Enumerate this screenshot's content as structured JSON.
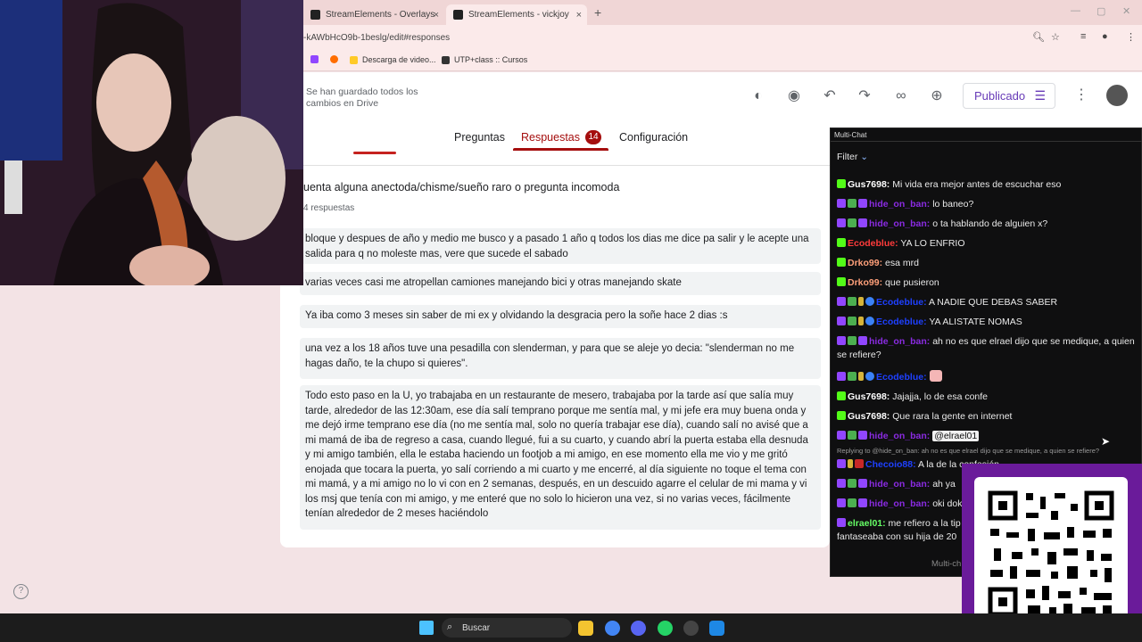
{
  "browser": {
    "tabs": [
      {
        "label": "StreamElements - Overlays",
        "close": "×"
      },
      {
        "label": "StreamElements - vickjoy",
        "close": "×"
      }
    ],
    "new_tab": "+",
    "url": "-kAWbHcO9b-1beslg/edit#responses",
    "bookmarks": [
      "Descarga de video...",
      "UTP+class :: Cursos"
    ]
  },
  "forms": {
    "saved_status": "Se han guardado todos los cambios en Drive",
    "publish_label": "Publicado",
    "tabs": {
      "questions": "Preguntas",
      "responses": "Respuestas",
      "settings": "Configuración"
    },
    "responses_count": "14",
    "question_title": "uenta alguna anectoda/chisme/sueño raro o pregunta incomoda",
    "question_count": "4 respuestas",
    "responses": [
      "bloque y despues de año y medio me busco y a pasado 1 año q todos los dias me dice pa salir y le acepte una salida para q no moleste mas, vere que sucede el sabado",
      "varias veces casi me atropellan camiones manejando bici y otras manejando skate",
      "Ya iba como 3 meses sin saber de mi ex y olvidando la desgracia pero la soñe hace 2 dias :s",
      "una vez a los 18 años tuve una pesadilla con slenderman, y para que se aleje yo decia: \"slenderman no me hagas daño, te la chupo si quieres\".",
      "Todo esto paso en la U, yo trabajaba en un restaurante de mesero, trabajaba por la tarde así que salía muy tarde, alrededor de las 12:30am, ese día salí temprano porque me sentía mal, y mi jefe era muy buena onda y me dejó irme temprano ese día (no me sentía mal, solo no quería trabajar ese día), cuando salí no avisé que a mi mamá de iba de regreso a casa, cuando llegué, fui a su cuarto, y cuando abrí la puerta estaba ella desnuda y mi amigo también, ella le estaba haciendo un footjob a mi amigo, en ese momento ella me vio y me gritó enojada que tocara la puerta, yo salí corriendo a mi cuarto y me encerré, al día siguiente no toque el tema con mi mamá, y a mi amigo no lo vi con en 2 semanas, después, en un descuido agarre el celular de mi mama y vi los msj que tenía con mi amigo, y me enteré que no solo lo hicieron una vez, si no varias veces, fácilmente tenían alrededor de 2 meses haciéndolo"
    ]
  },
  "chat": {
    "title": "Multi-Chat",
    "filter": "Filter",
    "messages": [
      {
        "user": "Gus7698:",
        "text": "Mi vida era mejor antes de escuchar eso"
      },
      {
        "user": "hide_on_ban:",
        "text": "lo baneo?"
      },
      {
        "user": "hide_on_ban:",
        "text": "o ta hablando de alguien x?"
      },
      {
        "user": "Ecodeblue:",
        "text": "YA LO ENFRIO"
      },
      {
        "user": "Drko99:",
        "text": "esa mrd"
      },
      {
        "user": "Drko99:",
        "text": "que pusieron"
      },
      {
        "user": "Ecodeblue:",
        "text": "A NADIE QUE DEBAS SABER"
      },
      {
        "user": "Ecodeblue:",
        "text": "YA ALISTATE NOMAS"
      },
      {
        "user": "hide_on_ban:",
        "text": "ah no es que elrael dijo que se medique, a quien se refiere?"
      },
      {
        "user": "Ecodeblue:",
        "text": ""
      },
      {
        "user": "Gus7698:",
        "text": "Jajajja, lo de esa confe"
      },
      {
        "user": "Gus7698:",
        "text": "Que rara la gente en internet"
      },
      {
        "user": "hide_on_ban:",
        "text": "@elrael01"
      },
      {
        "user": "Checoio88:",
        "text": "A la de la confesión"
      },
      {
        "user": "hide_on_ban:",
        "text": "ah ya"
      },
      {
        "user": "hide_on_ban:",
        "text": "oki dok"
      },
      {
        "user": "elrael01:",
        "text": "me refiero a la tip fantaseaba con su hija de 20"
      }
    ],
    "reply_note": "Replying to @hide_on_ban: ah no es que elrael dijo que se medique, a quien se refiere?",
    "footer": "Multi-ch"
  },
  "taskbar": {
    "search_label": "Buscar"
  },
  "icons": {
    "palette": "palette-icon",
    "preview": "eye-icon",
    "undo": "undo-icon",
    "redo": "redo-icon",
    "link": "link-icon",
    "add_collab": "person-add-icon",
    "more": "more-vert-icon",
    "help": "help-icon"
  },
  "colors": {
    "accent": "#a50e0e",
    "publish": "#673ab7",
    "chat_bg": "#0f0f10",
    "qr_bg": "#6a1b9a"
  }
}
